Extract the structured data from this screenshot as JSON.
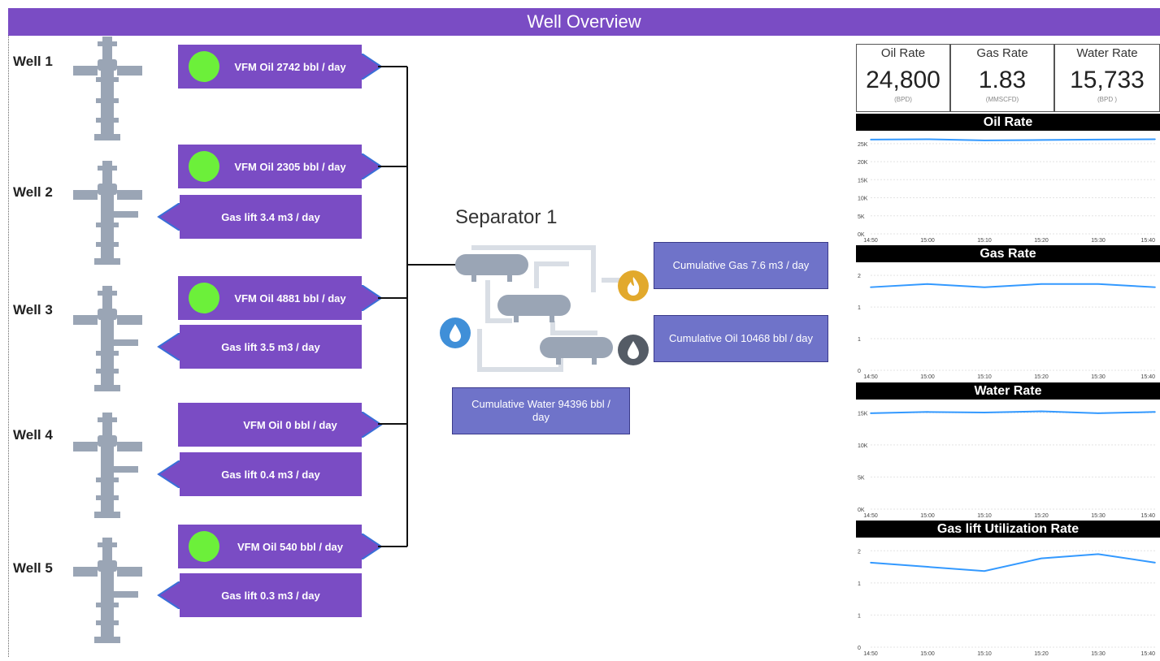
{
  "header": {
    "title": "Well Overview"
  },
  "wells": [
    {
      "label": "Well 1",
      "vfm_oil": "VFM Oil   2742 bbl / day",
      "vfm_status_on": true,
      "gas_lift": null
    },
    {
      "label": "Well 2",
      "vfm_oil": "VFM Oil   2305 bbl / day",
      "vfm_status_on": true,
      "gas_lift": "Gas lift   3.4   m3 / day"
    },
    {
      "label": "Well 3",
      "vfm_oil": "VFM Oil   4881 bbl / day",
      "vfm_status_on": true,
      "gas_lift": "Gas lift   3.5   m3 / day"
    },
    {
      "label": "Well 4",
      "vfm_oil": "VFM Oil   0 bbl / day",
      "vfm_status_on": false,
      "gas_lift": "Gas lift   0.4   m3 / day"
    },
    {
      "label": "Well 5",
      "vfm_oil": "VFM Oil   540 bbl / day",
      "vfm_status_on": true,
      "gas_lift": "Gas lift   0.3   m3 / day"
    }
  ],
  "separator": {
    "title": "Separator 1",
    "cumulative_gas": "Cumulative Gas 7.6 m3 / day",
    "cumulative_oil": "Cumulative Oil 10468 bbl / day",
    "cumulative_water": "Cumulative Water 94396 bbl / day",
    "icons": [
      "water-drop-icon",
      "flame-icon",
      "oil-drop-icon",
      "separator-vessels-icon"
    ]
  },
  "kpis": [
    {
      "label": "Oil Rate",
      "value": "24,800",
      "unit": "(BPD)"
    },
    {
      "label": "Gas Rate",
      "value": "1.83",
      "unit": "(MMSCFD)"
    },
    {
      "label": "Water Rate",
      "value": "15,733",
      "unit": "(BPD )"
    }
  ],
  "colors": {
    "accent_purple": "#7a4cc4",
    "status_green": "#6cf03a",
    "cumulative_box": "#6f73c9",
    "chart_line": "#3399ff"
  },
  "chart_data": [
    {
      "type": "line",
      "title": "Oil Rate",
      "x": [
        "14:50",
        "15:00",
        "15:10",
        "15:20",
        "15:30",
        "15:40"
      ],
      "x_ticks": [
        "14:50",
        "15:00",
        "15:10",
        "15:20",
        "15:30",
        "15:40"
      ],
      "y_ticks": [
        "0K",
        "5K",
        "10K",
        "15K",
        "20K",
        "25K"
      ],
      "ylim": [
        0,
        25000
      ],
      "series": [
        {
          "values": [
            24800,
            24900,
            24600,
            24700,
            24800,
            24900
          ]
        }
      ],
      "grid": true
    },
    {
      "type": "line",
      "title": "Gas Rate",
      "x": [
        "14:50",
        "15:00",
        "15:10",
        "15:20",
        "15:30",
        "15:40"
      ],
      "x_ticks": [
        "14:50",
        "15:00",
        "15:10",
        "15:20",
        "15:30",
        "15:40"
      ],
      "y_ticks": [
        "0",
        "1",
        "1",
        "2"
      ],
      "ylim": [
        0,
        2.2
      ],
      "series": [
        {
          "values": [
            1.83,
            1.9,
            1.83,
            1.9,
            1.9,
            1.83
          ]
        }
      ],
      "grid": true
    },
    {
      "type": "line",
      "title": "Water Rate",
      "x": [
        "14:50",
        "15:00",
        "15:10",
        "15:20",
        "15:30",
        "15:40"
      ],
      "x_ticks": [
        "14:50",
        "15:00",
        "15:10",
        "15:20",
        "15:30",
        "15:40"
      ],
      "y_ticks": [
        "0K",
        "5K",
        "10K",
        "15K"
      ],
      "ylim": [
        0,
        16500
      ],
      "series": [
        {
          "values": [
            15600,
            15800,
            15700,
            15900,
            15600,
            15800
          ]
        }
      ],
      "grid": true
    },
    {
      "type": "line",
      "title": "Gas lift Utilization Rate",
      "x": [
        "14:50",
        "15:00",
        "15:10",
        "15:20",
        "15:30",
        "15:40"
      ],
      "x_ticks": [
        "14:50",
        "15:00",
        "15:10",
        "15:20",
        "15:30",
        "15:40"
      ],
      "y_ticks": [
        "0",
        "1",
        "1",
        "2"
      ],
      "ylim": [
        0,
        2.4
      ],
      "series": [
        {
          "values": [
            2.0,
            1.9,
            1.8,
            2.1,
            2.2,
            2.0
          ]
        }
      ],
      "grid": true
    }
  ]
}
